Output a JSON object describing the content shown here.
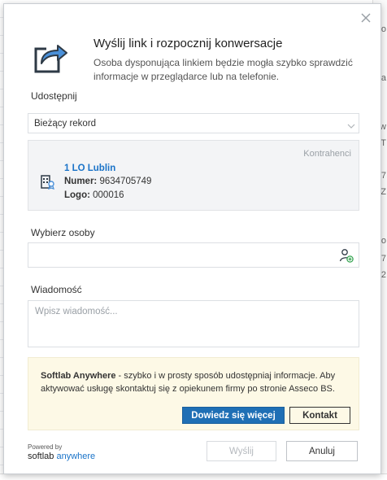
{
  "background": {
    "fragments": [
      "o",
      "a",
      "aw",
      "T",
      "7",
      "Z",
      "o",
      "7",
      "2"
    ]
  },
  "dialog": {
    "title": "Wyślij link i rozpocznij konwersacje",
    "subtitle": "Osoba dysponująca linkiem będzie mogła szybko sprawdzić informacje w przeglądarce lub na telefonie.",
    "icons": {
      "close": "close-icon",
      "share": "share-icon",
      "chevron": "chevron-down-icon",
      "record": "building-icon",
      "add_person": "add-person-icon"
    },
    "share": {
      "label": "Udostępnij",
      "selected": "Bieżący rekord"
    },
    "record": {
      "category": "Kontrahenci",
      "name": "1 LO Lublin",
      "number_label": "Numer:",
      "number_value": "9634705749",
      "logo_label": "Logo:",
      "logo_value": "000016"
    },
    "persons": {
      "label": "Wybierz osoby",
      "value": ""
    },
    "message": {
      "label": "Wiadomość",
      "placeholder": "Wpisz wiadomość...",
      "value": ""
    },
    "promo": {
      "brand": "Softlab Anywhere",
      "text": " - szybko i w prosty sposób udostępniaj informacje. Aby aktywować usługę skontaktuj się z opiekunem firmy po stronie Asseco BS.",
      "learn_more_label": "Dowiedz się więcej",
      "contact_label": "Kontakt"
    },
    "footer": {
      "powered_by": "Powered by",
      "brand_softlab": "softlab",
      "brand_anywhere": "anywhere",
      "send_label": "Wyślij",
      "cancel_label": "Anuluj"
    },
    "colors": {
      "accent": "#1f6fb5",
      "link": "#1a73c8",
      "promo_bg": "#fdf9e6",
      "card_bg": "#f3f4f6"
    }
  }
}
